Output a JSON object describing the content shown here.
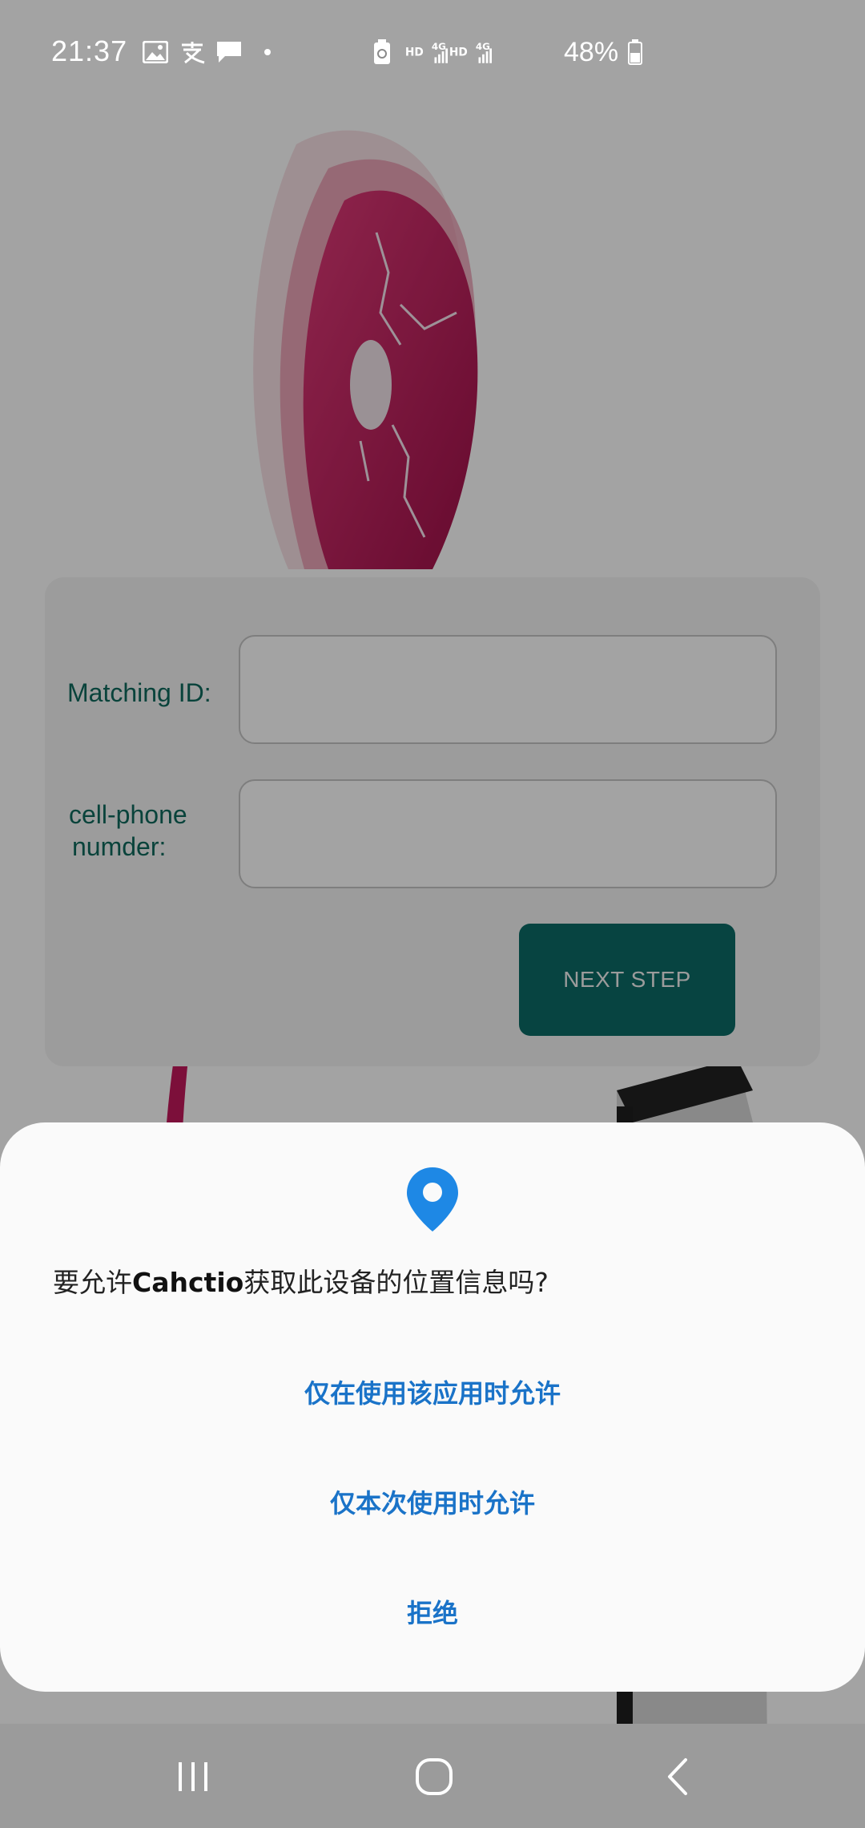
{
  "status_bar": {
    "time": "21:37",
    "battery_percent": "48%",
    "network_labels": [
      "HD",
      "4G",
      "HD",
      "4G"
    ],
    "icons": [
      "gallery-icon",
      "alipay-icon",
      "message-icon",
      "dot-icon",
      "recycle-icon",
      "signal-icon",
      "battery-icon"
    ]
  },
  "form": {
    "matching_id_label": "Matching ID:",
    "phone_label_line1": "cell-phone",
    "phone_label_line2": "numder:",
    "matching_id_value": "",
    "phone_value": "",
    "next_button_label": "NEXT STEP"
  },
  "dialog": {
    "icon": "location-pin-icon",
    "question_prefix": "要允许",
    "app_name": "Cahctio",
    "question_suffix": "获取此设备的位置信息吗?",
    "options": [
      {
        "label": "仅在使用该应用时允许"
      },
      {
        "label": "仅本次使用时允许"
      },
      {
        "label": "拒绝"
      }
    ]
  },
  "nav_bar": {
    "buttons": [
      "recent-apps-icon",
      "home-icon",
      "back-icon"
    ]
  },
  "colors": {
    "accent_blue": "#1a73c8",
    "pin_blue": "#1e88e5",
    "teal_button": "#0b6b66",
    "label_green": "#0f6a5d",
    "disc_magenta": "#c2185b"
  }
}
